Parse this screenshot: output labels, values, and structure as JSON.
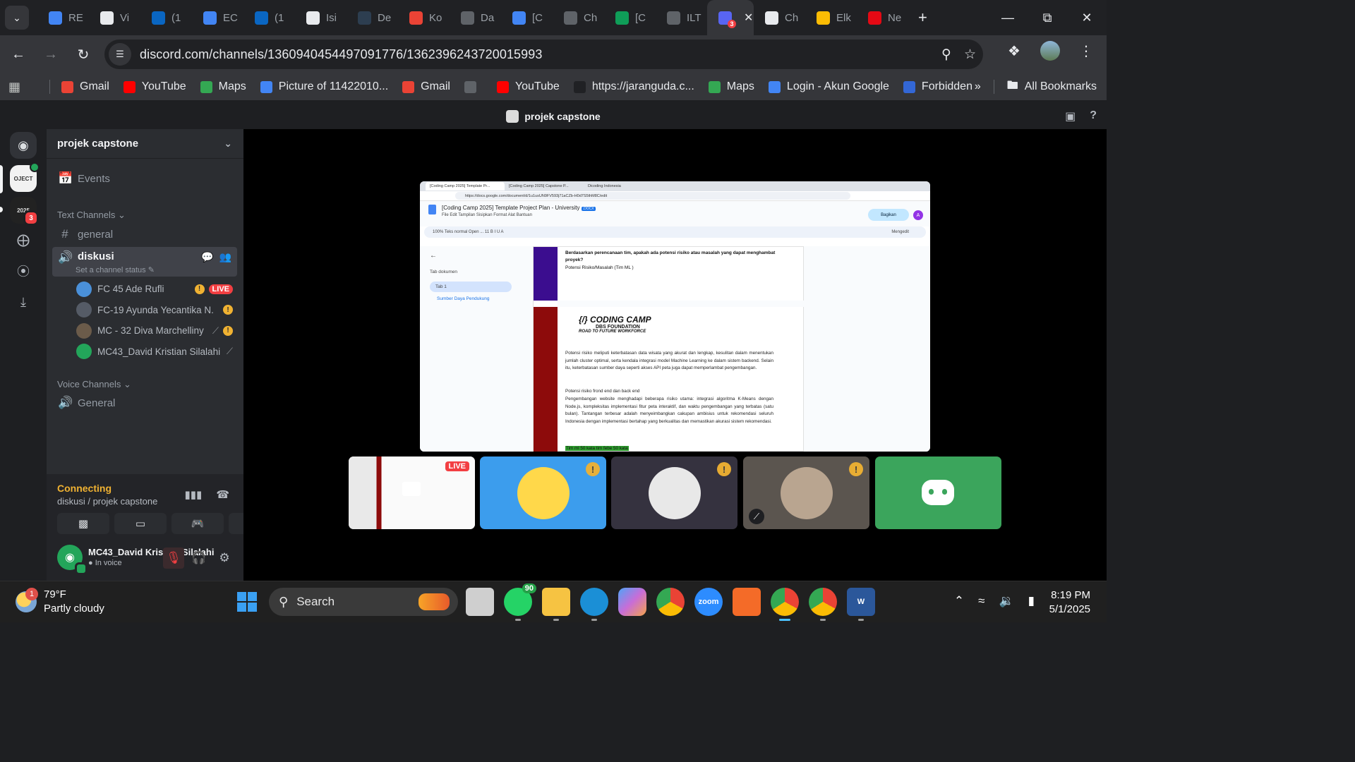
{
  "browser": {
    "tabs": [
      {
        "title": "RE",
        "icon": "doc-icon",
        "color": "#4285f4"
      },
      {
        "title": "Vi",
        "icon": "chatgpt-icon",
        "color": "#e8eaed"
      },
      {
        "title": "(1",
        "icon": "linkedin-icon",
        "color": "#0a66c2"
      },
      {
        "title": "EC",
        "icon": "doc-icon",
        "color": "#4285f4"
      },
      {
        "title": "(1",
        "icon": "linkedin-icon",
        "color": "#0a66c2"
      },
      {
        "title": "Isi",
        "icon": "chatgpt-icon",
        "color": "#e8eaed"
      },
      {
        "title": "De",
        "icon": "dicoding-icon",
        "color": "#2d3e50"
      },
      {
        "title": "Ko",
        "icon": "gmail-icon",
        "color": "#ea4335"
      },
      {
        "title": "Da",
        "icon": "g-icon",
        "color": "#5f6368"
      },
      {
        "title": "[C",
        "icon": "docs-icon",
        "color": "#4285f4"
      },
      {
        "title": "Ch",
        "icon": "globe-icon",
        "color": "#5f6368"
      },
      {
        "title": "[C",
        "icon": "sheets-icon",
        "color": "#0f9d58"
      },
      {
        "title": "ILT",
        "icon": "g-icon",
        "color": "#5f6368"
      }
    ],
    "active_tab": {
      "badge": "3",
      "icon": "discord-icon"
    },
    "tabs_after": [
      {
        "title": "Ch",
        "icon": "chatgpt-icon",
        "color": "#e8eaed"
      },
      {
        "title": "Elk",
        "icon": "drive-icon",
        "color": "#fbbc04"
      },
      {
        "title": "Ne",
        "icon": "netflix-icon",
        "color": "#e50914"
      }
    ],
    "url": "discord.com/channels/1360940454497091776/1362396243720015993",
    "bookmarks": [
      {
        "label": "Gmail",
        "icon": "gmail-icon",
        "color": "#ea4335"
      },
      {
        "label": "YouTube",
        "icon": "youtube-icon",
        "color": "#ff0000"
      },
      {
        "label": "Maps",
        "icon": "maps-icon",
        "color": "#34a853"
      },
      {
        "label": "Picture of 11422010...",
        "icon": "doc-icon",
        "color": "#4285f4"
      },
      {
        "label": "Gmail",
        "icon": "gmail-icon",
        "color": "#ea4335"
      },
      {
        "label": "",
        "icon": "globe-icon",
        "color": "#5f6368"
      },
      {
        "label": "YouTube",
        "icon": "youtube-icon",
        "color": "#ff0000"
      },
      {
        "label": "https://jaranguda.c...",
        "icon": "j-icon",
        "color": "#202124"
      },
      {
        "label": "Maps",
        "icon": "maps-icon",
        "color": "#34a853"
      },
      {
        "label": "Login - Akun Google",
        "icon": "google-icon",
        "color": "#4285f4"
      },
      {
        "label": "Forbidden",
        "icon": "del-icon",
        "color": "#3367d6"
      }
    ],
    "all_bookmarks": "All Bookmarks"
  },
  "discord": {
    "window_title": "projek capstone",
    "server_name": "projek capstone",
    "events": "Events",
    "text_channels_label": "Text Channels",
    "general_text": "general",
    "voice_channel": "diskusi",
    "set_status": "Set a channel status",
    "voice_users": [
      {
        "name": "FC 45 Ade Rufli",
        "warn": true,
        "live": true,
        "muted": false,
        "color": "#4a90d9"
      },
      {
        "name": "FC-19 Ayunda Yecantika N.",
        "warn": true,
        "live": false,
        "muted": false,
        "color": "#555b66"
      },
      {
        "name": "MC - 32 Diva Marchelliny",
        "warn": true,
        "live": false,
        "muted": true,
        "color": "#6b5b4a"
      },
      {
        "name": "MC43_David Kristian Silalahi",
        "warn": false,
        "live": false,
        "muted": true,
        "color": "#23a55a"
      }
    ],
    "live_label": "LIVE",
    "voice_channels_label": "Voice Channels",
    "general_voice": "General",
    "connection": {
      "status": "Connecting",
      "location": "diskusi / projek capstone"
    },
    "user": {
      "name": "MC43_David Kristian Silalahi",
      "status": "In voice"
    }
  },
  "shared_screen": {
    "tabs": [
      "[Coding Camp 2025] Template Pr...",
      "[Coding Camp 2025] Capstone P...",
      "Dicoding Indonesia"
    ],
    "url": "https://docs.google.com/document/d/1u1usUN9FV593j71aCZb-H0d7S5thM8C/edit",
    "doc_title": "[Coding Camp 2025] Template Project Plan - University",
    "doc_badge": ".DOCX",
    "menus": "File   Edit   Tampilan   Sisipkan   Format   Alat   Bantuan",
    "toolbar": "100%    Teks normal    Open ...    11    B  I  U  A",
    "mode": "Mengedit",
    "share": "Bagikan",
    "account": "A",
    "sidebar": {
      "title": "Tab dokumen",
      "tab": "Tab 1",
      "sub": "Sumber Daya Pendukung"
    },
    "question": "Berdasarkan perencanaan tim, apakah ada potensi risiko atau masalah yang dapat menghambat proyek?",
    "question_sub": "Potensi Risiko/Masalah (Tim ML )",
    "logo": {
      "line1": "{/} CODING CAMP",
      "line2": "DBS FOUNDATION",
      "line3": "ROAD TO FUTURE WORKFORCE"
    },
    "para1": "Potensi risiko meliputi keterbatasan data wisata yang akurat dan lengkap, kesulitan dalam menentukan jumlah cluster optimal, serta kendala integrasi model Machine Learning ke dalam sistem backend. Selain itu, keterbatasan sumber daya seperti akses API peta juga dapat memperlambat pengembangan.",
    "para2_title": "Potensi risiko frond end dan back end",
    "para2": "Pengembangan website menghadapi beberapa risiko utama: integrasi algoritma K-Means dengan Node.js, kompleksitas implementasi fitur peta interaktif, dan waktu pengembangan yang terbatas (satu bulan). Tantangan terbesar adalah menyeimbangkan cakupan ambisius untuk rekomendasi seluruh Indonesia dengan implementasi bertahap yang berkualitas dan memastikan akurasi sistem rekomendasi.",
    "highlight": "Tim ml 50 kata tim febe 50 kata"
  },
  "tiles": [
    {
      "type": "screen",
      "live": "LIVE"
    },
    {
      "type": "avatar",
      "color": "#3c9ded",
      "warn": "!"
    },
    {
      "type": "avatar",
      "color": "#35323f",
      "warn": "!"
    },
    {
      "type": "avatar",
      "color": "#5b554f",
      "warn": "!",
      "muted": true
    },
    {
      "type": "discord",
      "color": "#3ba55c"
    }
  ],
  "taskbar": {
    "weather_temp": "79°F",
    "weather_desc": "Partly cloudy",
    "weather_badge": "1",
    "search": "Search",
    "whatsapp_badge": "90",
    "time": "8:19 PM",
    "date": "5/1/2025"
  }
}
